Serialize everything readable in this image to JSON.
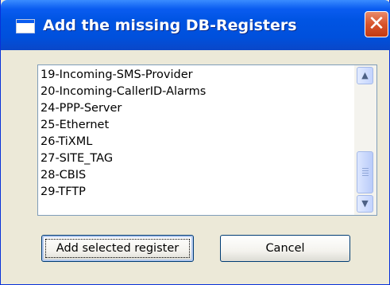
{
  "window": {
    "title": "Add the missing DB-Registers",
    "close_glyph": "✕"
  },
  "registers": {
    "items": [
      "19-Incoming-SMS-Provider",
      "20-Incoming-CallerID-Alarms",
      "24-PPP-Server",
      "25-Ethernet",
      "26-TiXML",
      "27-SITE_TAG",
      "28-CBIS",
      "29-TFTP"
    ]
  },
  "buttons": {
    "add_label": "Add selected register",
    "cancel_label": "Cancel"
  },
  "icons": {
    "window": "window-icon",
    "close": "close-icon",
    "scroll_up": "scroll-up-arrow-icon",
    "scroll_down": "scroll-down-arrow-icon"
  },
  "colors": {
    "titlebar": "#0054e3",
    "close_button": "#d8542c",
    "dialog_background": "#ece9d8"
  }
}
